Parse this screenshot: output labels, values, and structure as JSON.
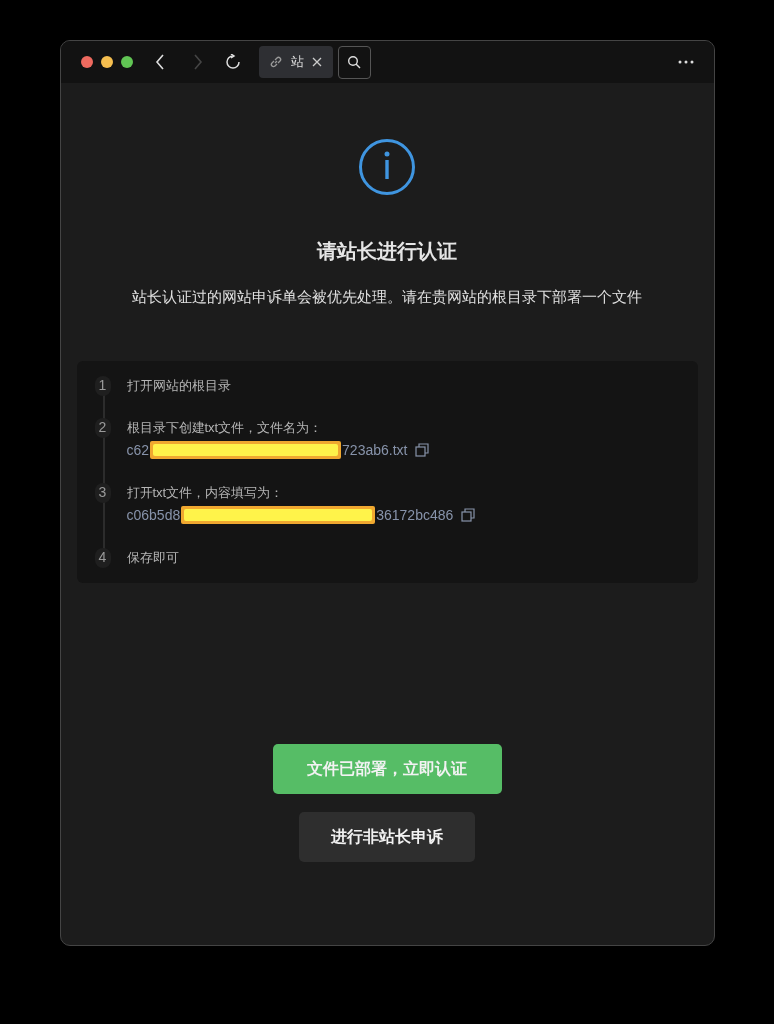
{
  "tab": {
    "label": "站"
  },
  "title": "请站长进行认证",
  "subtitle": "站长认证过的网站申诉单会被优先处理。请在贵网站的根目录下部署一个文件",
  "steps": [
    {
      "number": "1",
      "text": "打开网站的根目录"
    },
    {
      "number": "2",
      "text": "根目录下创建txt文件，文件名为：",
      "code_prefix": "c62",
      "code_suffix": "723ab6.txt"
    },
    {
      "number": "3",
      "text": "打开txt文件，内容填写为：",
      "code_prefix": "c06b5d8",
      "code_suffix": "36172bc486"
    },
    {
      "number": "4",
      "text": "保存即可"
    }
  ],
  "buttons": [
    {
      "kind": "primary",
      "label": "文件已部署，立即认证"
    },
    {
      "kind": "secondary",
      "label": "进行非站长申诉"
    }
  ]
}
